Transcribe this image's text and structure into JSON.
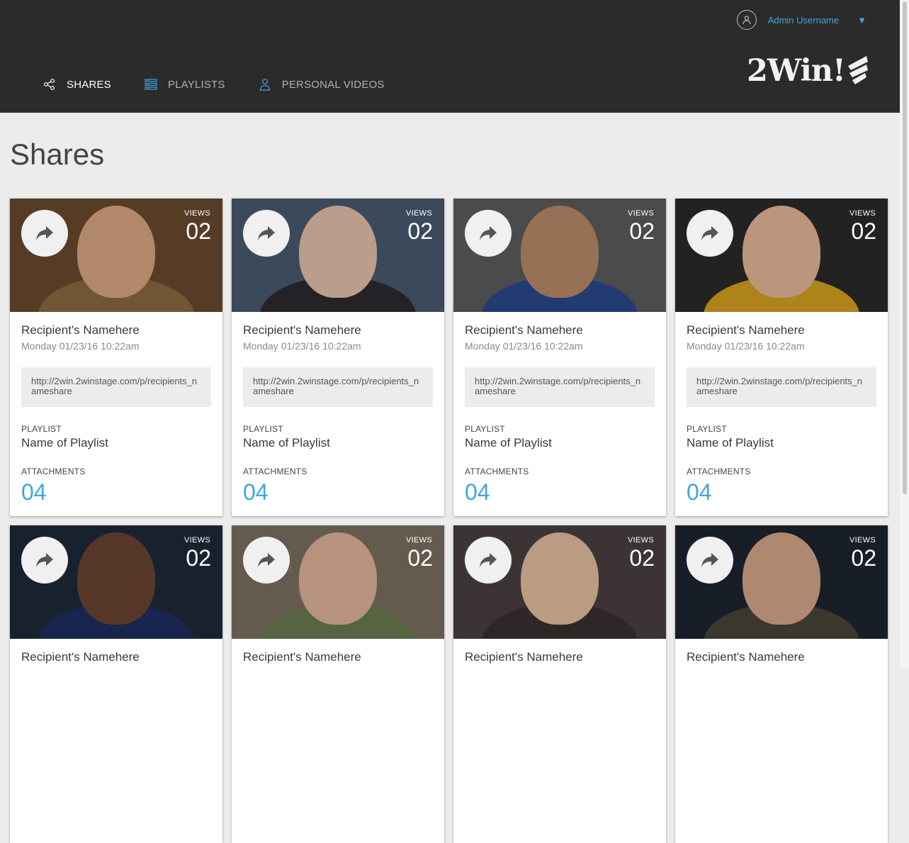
{
  "header": {
    "user_name": "Admin Username",
    "logo_text": "2Win!",
    "nav": [
      {
        "label": "SHARES",
        "icon": "share-icon",
        "active": true
      },
      {
        "label": "PLAYLISTS",
        "icon": "list-icon",
        "active": false
      },
      {
        "label": "PERSONAL VIDEOS",
        "icon": "person-icon",
        "active": false
      }
    ]
  },
  "page": {
    "title": "Shares"
  },
  "labels": {
    "views": "VIEWS",
    "playlist": "PLAYLIST",
    "attachments": "ATTACHMENTS"
  },
  "colors": {
    "accent": "#3fa6e0",
    "header_bg": "#2b2b2b",
    "page_bg": "#ececec"
  },
  "cards": [
    {
      "views": "02",
      "recipient": "Recipient's Namehere",
      "date": "Monday 01/23/16 10:22am",
      "link": "http://2win.2winstage.com/p/recipients_nameshare",
      "playlist": "Name of Playlist",
      "attachments": "04"
    },
    {
      "views": "02",
      "recipient": "Recipient's Namehere",
      "date": "Monday 01/23/16 10:22am",
      "link": "http://2win.2winstage.com/p/recipients_nameshare",
      "playlist": "Name of Playlist",
      "attachments": "04"
    },
    {
      "views": "02",
      "recipient": "Recipient's Namehere",
      "date": "Monday 01/23/16 10:22am",
      "link": "http://2win.2winstage.com/p/recipients_nameshare",
      "playlist": "Name of Playlist",
      "attachments": "04"
    },
    {
      "views": "02",
      "recipient": "Recipient's Namehere",
      "date": "Monday 01/23/16 10:22am",
      "link": "http://2win.2winstage.com/p/recipients_nameshare",
      "playlist": "Name of Playlist",
      "attachments": "04"
    },
    {
      "views": "02",
      "recipient": "Recipient's Namehere"
    },
    {
      "views": "02",
      "recipient": "Recipient's Namehere"
    },
    {
      "views": "02",
      "recipient": "Recipient's Namehere"
    },
    {
      "views": "02",
      "recipient": "Recipient's Namehere"
    }
  ]
}
